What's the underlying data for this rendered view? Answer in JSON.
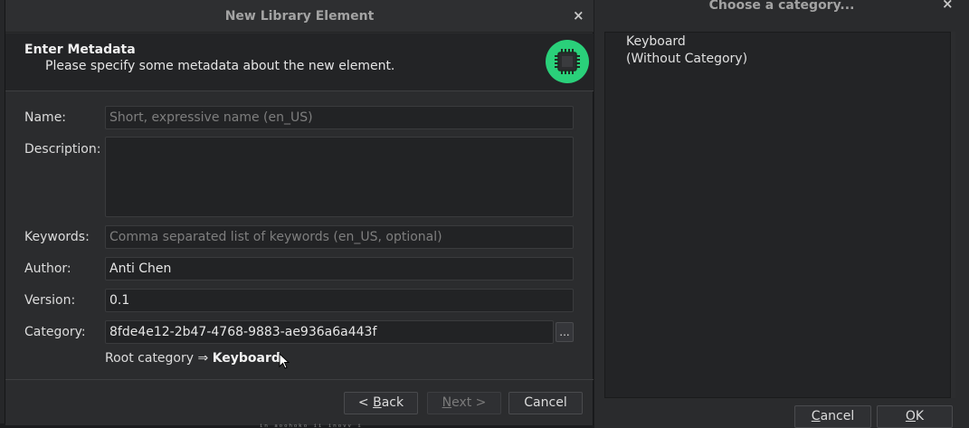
{
  "main_dialog": {
    "title": "New Library Element",
    "close_glyph": "×",
    "header": {
      "title": "Enter Metadata",
      "subtitle": "Please specify some metadata about the new element.",
      "icon": "chip-icon",
      "icon_bg": "#2ad07a"
    },
    "form": {
      "name": {
        "label": "Name:",
        "value": "",
        "placeholder": "Short, expressive name (en_US)"
      },
      "description": {
        "label": "Description:",
        "value": ""
      },
      "keywords": {
        "label": "Keywords:",
        "value": "",
        "placeholder": "Comma separated list of keywords (en_US, optional)"
      },
      "author": {
        "label": "Author:",
        "value": "Anti Chen"
      },
      "version": {
        "label": "Version:",
        "value": "0.1"
      },
      "category": {
        "label": "Category:",
        "value": "8fde4e12-2b47-4768-9883-ae936a6a443f",
        "browse_label": "...",
        "path_prefix": "Root category ⇒",
        "path_leaf": "Keyboard"
      }
    },
    "buttons": {
      "back": {
        "label_pre": "< ",
        "mnemonic": "B",
        "label_post": "ack"
      },
      "next": {
        "mnemonic": "N",
        "label_post": "ext >",
        "enabled": false
      },
      "cancel": {
        "label": "Cancel"
      }
    }
  },
  "category_chooser": {
    "title": "Choose a category...",
    "close_glyph": "×",
    "items": [
      "Keyboard",
      "(Without Category)"
    ],
    "buttons": {
      "cancel": {
        "mnemonic": "C",
        "label_post": "ancel"
      },
      "ok": {
        "mnemonic": "O",
        "label_post": "K"
      }
    }
  },
  "background": {
    "partial_text": "ᵢₙ ₐₒₒₕₒₖₒ ᵢᵢ ᵢₙₒᵥᵥ ᵢ"
  },
  "colors": {
    "accent": "#2ad07a",
    "dialog_bg": "#2b2c2e",
    "field_bg": "#222325"
  }
}
